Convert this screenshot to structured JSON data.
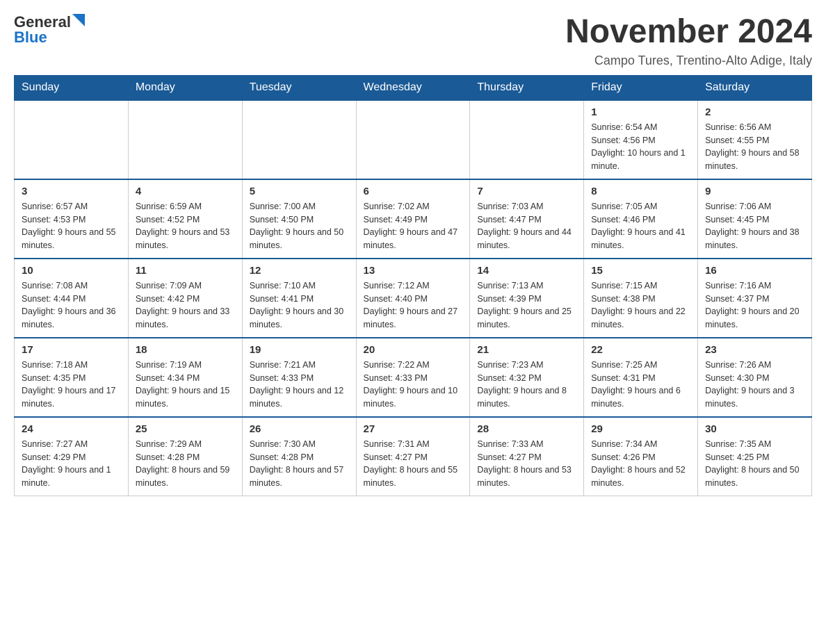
{
  "header": {
    "logo_general": "General",
    "logo_blue": "Blue",
    "month_title": "November 2024",
    "subtitle": "Campo Tures, Trentino-Alto Adige, Italy"
  },
  "days_of_week": [
    "Sunday",
    "Monday",
    "Tuesday",
    "Wednesday",
    "Thursday",
    "Friday",
    "Saturday"
  ],
  "weeks": [
    [
      {
        "day": "",
        "info": ""
      },
      {
        "day": "",
        "info": ""
      },
      {
        "day": "",
        "info": ""
      },
      {
        "day": "",
        "info": ""
      },
      {
        "day": "",
        "info": ""
      },
      {
        "day": "1",
        "info": "Sunrise: 6:54 AM\nSunset: 4:56 PM\nDaylight: 10 hours and 1 minute."
      },
      {
        "day": "2",
        "info": "Sunrise: 6:56 AM\nSunset: 4:55 PM\nDaylight: 9 hours and 58 minutes."
      }
    ],
    [
      {
        "day": "3",
        "info": "Sunrise: 6:57 AM\nSunset: 4:53 PM\nDaylight: 9 hours and 55 minutes."
      },
      {
        "day": "4",
        "info": "Sunrise: 6:59 AM\nSunset: 4:52 PM\nDaylight: 9 hours and 53 minutes."
      },
      {
        "day": "5",
        "info": "Sunrise: 7:00 AM\nSunset: 4:50 PM\nDaylight: 9 hours and 50 minutes."
      },
      {
        "day": "6",
        "info": "Sunrise: 7:02 AM\nSunset: 4:49 PM\nDaylight: 9 hours and 47 minutes."
      },
      {
        "day": "7",
        "info": "Sunrise: 7:03 AM\nSunset: 4:47 PM\nDaylight: 9 hours and 44 minutes."
      },
      {
        "day": "8",
        "info": "Sunrise: 7:05 AM\nSunset: 4:46 PM\nDaylight: 9 hours and 41 minutes."
      },
      {
        "day": "9",
        "info": "Sunrise: 7:06 AM\nSunset: 4:45 PM\nDaylight: 9 hours and 38 minutes."
      }
    ],
    [
      {
        "day": "10",
        "info": "Sunrise: 7:08 AM\nSunset: 4:44 PM\nDaylight: 9 hours and 36 minutes."
      },
      {
        "day": "11",
        "info": "Sunrise: 7:09 AM\nSunset: 4:42 PM\nDaylight: 9 hours and 33 minutes."
      },
      {
        "day": "12",
        "info": "Sunrise: 7:10 AM\nSunset: 4:41 PM\nDaylight: 9 hours and 30 minutes."
      },
      {
        "day": "13",
        "info": "Sunrise: 7:12 AM\nSunset: 4:40 PM\nDaylight: 9 hours and 27 minutes."
      },
      {
        "day": "14",
        "info": "Sunrise: 7:13 AM\nSunset: 4:39 PM\nDaylight: 9 hours and 25 minutes."
      },
      {
        "day": "15",
        "info": "Sunrise: 7:15 AM\nSunset: 4:38 PM\nDaylight: 9 hours and 22 minutes."
      },
      {
        "day": "16",
        "info": "Sunrise: 7:16 AM\nSunset: 4:37 PM\nDaylight: 9 hours and 20 minutes."
      }
    ],
    [
      {
        "day": "17",
        "info": "Sunrise: 7:18 AM\nSunset: 4:35 PM\nDaylight: 9 hours and 17 minutes."
      },
      {
        "day": "18",
        "info": "Sunrise: 7:19 AM\nSunset: 4:34 PM\nDaylight: 9 hours and 15 minutes."
      },
      {
        "day": "19",
        "info": "Sunrise: 7:21 AM\nSunset: 4:33 PM\nDaylight: 9 hours and 12 minutes."
      },
      {
        "day": "20",
        "info": "Sunrise: 7:22 AM\nSunset: 4:33 PM\nDaylight: 9 hours and 10 minutes."
      },
      {
        "day": "21",
        "info": "Sunrise: 7:23 AM\nSunset: 4:32 PM\nDaylight: 9 hours and 8 minutes."
      },
      {
        "day": "22",
        "info": "Sunrise: 7:25 AM\nSunset: 4:31 PM\nDaylight: 9 hours and 6 minutes."
      },
      {
        "day": "23",
        "info": "Sunrise: 7:26 AM\nSunset: 4:30 PM\nDaylight: 9 hours and 3 minutes."
      }
    ],
    [
      {
        "day": "24",
        "info": "Sunrise: 7:27 AM\nSunset: 4:29 PM\nDaylight: 9 hours and 1 minute."
      },
      {
        "day": "25",
        "info": "Sunrise: 7:29 AM\nSunset: 4:28 PM\nDaylight: 8 hours and 59 minutes."
      },
      {
        "day": "26",
        "info": "Sunrise: 7:30 AM\nSunset: 4:28 PM\nDaylight: 8 hours and 57 minutes."
      },
      {
        "day": "27",
        "info": "Sunrise: 7:31 AM\nSunset: 4:27 PM\nDaylight: 8 hours and 55 minutes."
      },
      {
        "day": "28",
        "info": "Sunrise: 7:33 AM\nSunset: 4:27 PM\nDaylight: 8 hours and 53 minutes."
      },
      {
        "day": "29",
        "info": "Sunrise: 7:34 AM\nSunset: 4:26 PM\nDaylight: 8 hours and 52 minutes."
      },
      {
        "day": "30",
        "info": "Sunrise: 7:35 AM\nSunset: 4:25 PM\nDaylight: 8 hours and 50 minutes."
      }
    ]
  ]
}
